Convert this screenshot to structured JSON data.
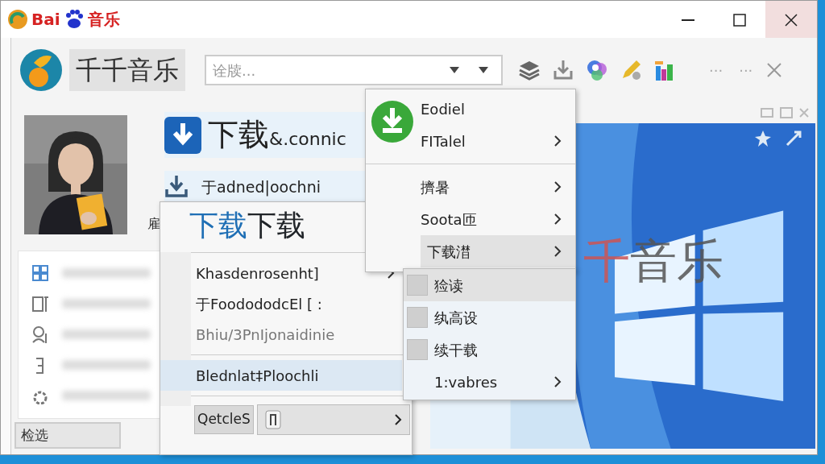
{
  "title_bar": {
    "brand": "Bai",
    "brand_suffix": "音乐"
  },
  "app": {
    "name": "千千音乐",
    "search": {
      "placeholder": "诠牍..."
    },
    "more": [
      "···",
      "···"
    ]
  },
  "profile": {
    "cut_label": "雇"
  },
  "header": {
    "title": "下载",
    "suffix": "&.connic",
    "subtitle": "于adned|oochni"
  },
  "side_list": [
    {
      "kind": "grid"
    },
    {
      "kind": "doc"
    },
    {
      "kind": "people"
    },
    {
      "kind": "bracket"
    },
    {
      "kind": "gear"
    }
  ],
  "filter_field": {
    "value": "检选"
  },
  "preview": {
    "accent": "千",
    "text": "音乐"
  },
  "menu": {
    "title_accent": "下载",
    "title": "下载",
    "items": [
      {
        "kind": "item",
        "label": "Khasdenrosenht]",
        "disabled": false,
        "selected": false,
        "submenu": true
      },
      {
        "kind": "item",
        "label": "于FoodododcEl [ :",
        "disabled": false,
        "selected": false,
        "submenu": false
      },
      {
        "kind": "item",
        "label": "Bhiu/3PnIjonaidinie",
        "disabled": true,
        "selected": false,
        "submenu": false
      },
      {
        "kind": "separator"
      },
      {
        "kind": "item",
        "label": "Blednlat‡Ploochli",
        "disabled": false,
        "selected": true,
        "submenu": false
      },
      {
        "kind": "separator"
      }
    ],
    "footer_button": "QetcleS"
  },
  "context_menu": {
    "items": [
      {
        "kind": "item",
        "label": "Eodiel",
        "submenu": false,
        "selected": false
      },
      {
        "kind": "item",
        "label": "FITalel",
        "submenu": true,
        "selected": false
      },
      {
        "kind": "separator"
      },
      {
        "kind": "item",
        "label": "擠暑",
        "submenu": true,
        "selected": false
      },
      {
        "kind": "item",
        "label": "Soota匝",
        "submenu": true,
        "selected": false
      },
      {
        "kind": "item",
        "label": "下载澘",
        "submenu": true,
        "selected": true
      }
    ]
  },
  "submenu": {
    "items": [
      {
        "kind": "check",
        "label": "猃读",
        "checked": false,
        "selected": true
      },
      {
        "kind": "check",
        "label": "纨高设",
        "checked": false,
        "selected": false
      },
      {
        "kind": "check",
        "label": "续干载",
        "checked": false,
        "selected": false
      },
      {
        "kind": "arrow",
        "label": "1:vabres",
        "selected": false
      }
    ]
  }
}
